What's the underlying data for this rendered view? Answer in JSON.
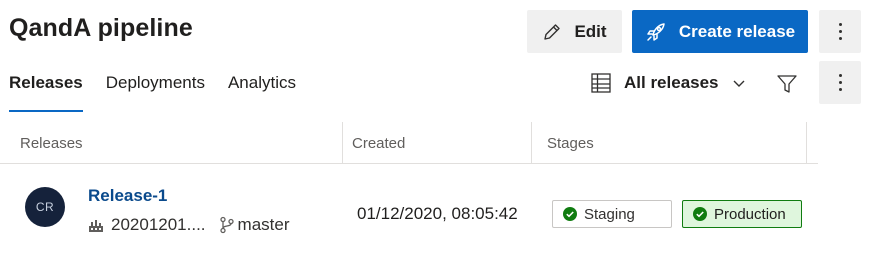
{
  "header": {
    "title": "QandA pipeline",
    "edit_label": "Edit",
    "create_label": "Create release"
  },
  "tabs": [
    {
      "label": "Releases",
      "active": true
    },
    {
      "label": "Deployments",
      "active": false
    },
    {
      "label": "Analytics",
      "active": false
    }
  ],
  "toolbar": {
    "view_label": "All releases"
  },
  "table": {
    "columns": [
      "Releases",
      "Created",
      "Stages"
    ],
    "rows": [
      {
        "avatar_initials": "CR",
        "name": "Release-1",
        "build": "20201201....",
        "branch": "master",
        "created": "01/12/2020, 08:05:42",
        "stages": [
          {
            "name": "Staging",
            "status": "succeeded"
          },
          {
            "name": "Production",
            "status": "succeeded"
          }
        ]
      }
    ]
  },
  "colors": {
    "accent": "#0a68c4",
    "success": "#107c10",
    "success_bg": "#dff6dd",
    "avatar_bg": "#15223b"
  }
}
